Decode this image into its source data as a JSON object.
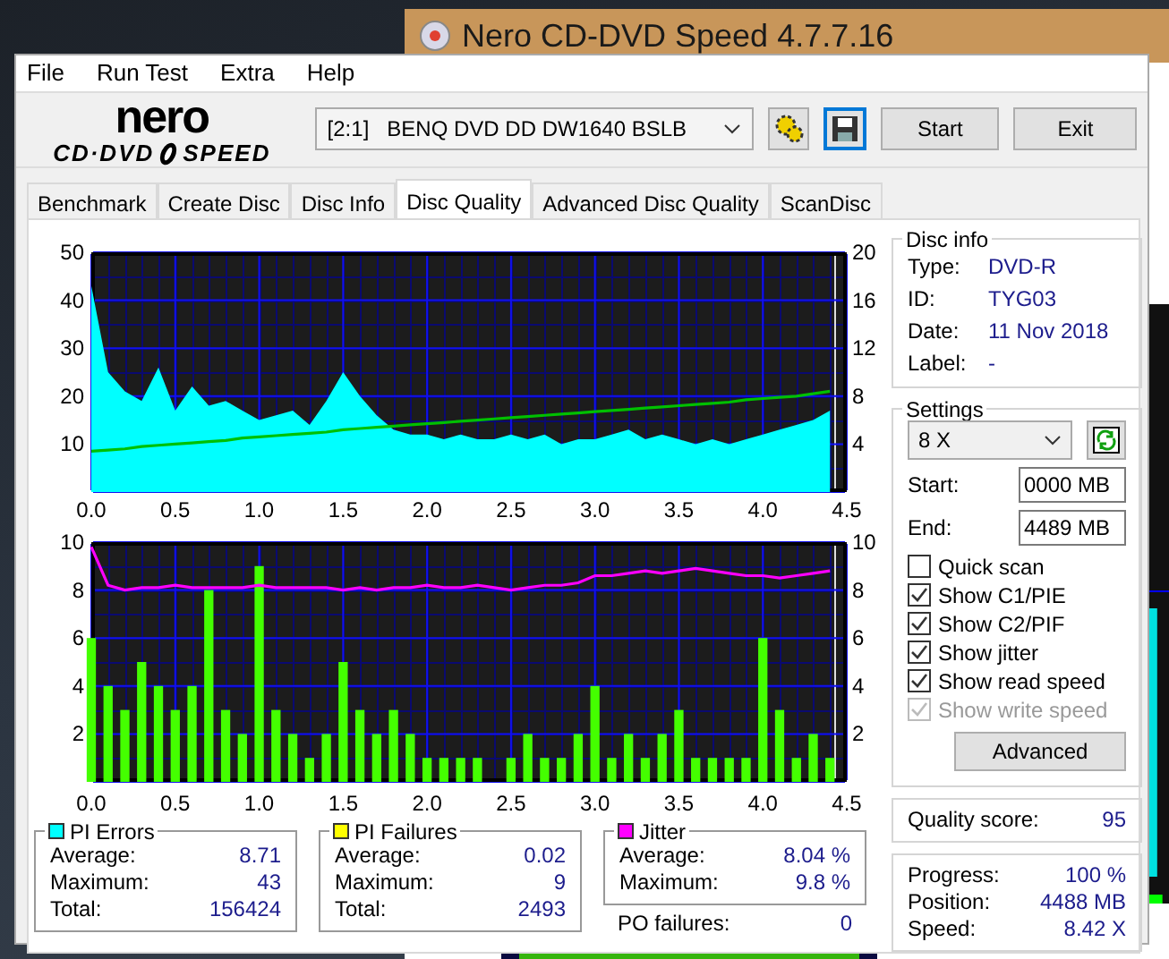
{
  "background_window": {
    "title": "Nero CD-DVD Speed 4.7.7.16"
  },
  "menu": [
    "File",
    "Run Test",
    "Extra",
    "Help"
  ],
  "logo": {
    "top": "nero",
    "left": "CD·DVD",
    "right": "SPEED"
  },
  "drive": {
    "id": "[2:1]",
    "name": "BENQ DVD DD DW1640 BSLB"
  },
  "buttons": [
    "Start",
    "Exit"
  ],
  "tabs": [
    {
      "label": "Benchmark",
      "selected": false
    },
    {
      "label": "Create Disc",
      "selected": false
    },
    {
      "label": "Disc Info",
      "selected": false
    },
    {
      "label": "Disc Quality",
      "selected": true
    },
    {
      "label": "Advanced Disc Quality",
      "selected": false
    },
    {
      "label": "ScanDisc",
      "selected": false
    }
  ],
  "charts": [
    {
      "chart_data": {
        "type": "area",
        "grid": true,
        "xlim": [
          0,
          4.5
        ],
        "ylim": [
          0,
          50
        ],
        "y2lim": [
          0,
          20
        ],
        "xticks": [
          {
            "value": 0,
            "label": "0.0"
          },
          {
            "value": 0.5,
            "label": "0.5"
          },
          {
            "value": 1,
            "label": "1.0"
          },
          {
            "value": 1.5,
            "label": "1.5"
          },
          {
            "value": 2,
            "label": "2.0"
          },
          {
            "value": 2.5,
            "label": "2.5"
          },
          {
            "value": 3,
            "label": "3.0"
          },
          {
            "value": 3.5,
            "label": "3.5"
          },
          {
            "value": 4,
            "label": "4.0"
          },
          {
            "value": 4.5,
            "label": "4.5"
          }
        ],
        "yticks": [
          {
            "value": 10,
            "label": "10"
          },
          {
            "value": 20,
            "label": "20"
          },
          {
            "value": 30,
            "label": "30"
          },
          {
            "value": 40,
            "label": "40"
          },
          {
            "value": 50,
            "label": "50"
          }
        ],
        "y2ticks": [
          {
            "value": 4,
            "label": "4"
          },
          {
            "value": 8,
            "label": "8"
          },
          {
            "value": 12,
            "label": "12"
          },
          {
            "value": 16,
            "label": "16"
          },
          {
            "value": 20,
            "label": "20"
          }
        ],
        "x": [
          0,
          0.1,
          0.2,
          0.3,
          0.4,
          0.5,
          0.6,
          0.7,
          0.8,
          0.9,
          1,
          1.1,
          1.2,
          1.3,
          1.4,
          1.5,
          1.6,
          1.7,
          1.8,
          1.9,
          2,
          2.1,
          2.2,
          2.3,
          2.4,
          2.5,
          2.6,
          2.7,
          2.8,
          2.9,
          3,
          3.1,
          3.2,
          3.3,
          3.4,
          3.5,
          3.6,
          3.7,
          3.8,
          3.9,
          4,
          4.1,
          4.2,
          4.3,
          4.4
        ],
        "series": [
          {
            "color": "#00ffff",
            "values": [
              43,
              25,
              21,
              19,
              26,
              17,
              22,
              18,
              19,
              17,
              15,
              16,
              17,
              14,
              19,
              25,
              20,
              16,
              13,
              12,
              12,
              11,
              12,
              11,
              11,
              12,
              11,
              12,
              10,
              11,
              11,
              12,
              13,
              11,
              12,
              11,
              10,
              11,
              10,
              11,
              12,
              13,
              14,
              15,
              17
            ]
          },
          {
            "type": "line",
            "axis": "y2",
            "color": "#00c000",
            "values": [
              3.4,
              3.5,
              3.6,
              3.8,
              3.9,
              4.0,
              4.1,
              4.2,
              4.3,
              4.5,
              4.6,
              4.7,
              4.8,
              4.9,
              5.0,
              5.2,
              5.3,
              5.4,
              5.5,
              5.6,
              5.7,
              5.8,
              5.9,
              6.0,
              6.1,
              6.2,
              6.3,
              6.4,
              6.5,
              6.6,
              6.7,
              6.8,
              6.9,
              7.0,
              7.1,
              7.2,
              7.3,
              7.4,
              7.5,
              7.7,
              7.8,
              7.9,
              8.0,
              8.2,
              8.4
            ]
          }
        ]
      }
    },
    {
      "chart_data": {
        "type": "bar",
        "grid": true,
        "xlim": [
          0,
          4.5
        ],
        "ylim": [
          0,
          10
        ],
        "y2lim": [
          0,
          10
        ],
        "xticks": [
          {
            "value": 0,
            "label": "0.0"
          },
          {
            "value": 0.5,
            "label": "0.5"
          },
          {
            "value": 1,
            "label": "1.0"
          },
          {
            "value": 1.5,
            "label": "1.5"
          },
          {
            "value": 2,
            "label": "2.0"
          },
          {
            "value": 2.5,
            "label": "2.5"
          },
          {
            "value": 3,
            "label": "3.0"
          },
          {
            "value": 3.5,
            "label": "3.5"
          },
          {
            "value": 4,
            "label": "4.0"
          },
          {
            "value": 4.5,
            "label": "4.5"
          }
        ],
        "yticks": [
          2,
          4,
          6,
          8,
          10
        ],
        "y2ticks": [
          2,
          4,
          6,
          8,
          10
        ],
        "x": [
          0,
          0.1,
          0.2,
          0.3,
          0.4,
          0.5,
          0.6,
          0.7,
          0.8,
          0.9,
          1,
          1.1,
          1.2,
          1.3,
          1.4,
          1.5,
          1.6,
          1.7,
          1.8,
          1.9,
          2,
          2.1,
          2.2,
          2.3,
          2.4,
          2.5,
          2.6,
          2.7,
          2.8,
          2.9,
          3,
          3.1,
          3.2,
          3.3,
          3.4,
          3.5,
          3.6,
          3.7,
          3.8,
          3.9,
          4,
          4.1,
          4.2,
          4.3,
          4.4
        ],
        "series": [
          {
            "color": "#44ff00",
            "values": [
              6,
              4,
              3,
              5,
              4,
              3,
              4,
              8,
              3,
              2,
              9,
              3,
              2,
              1,
              2,
              5,
              3,
              2,
              3,
              2,
              1,
              1,
              1,
              1,
              0,
              1,
              2,
              1,
              1,
              2,
              4,
              1,
              2,
              1,
              2,
              3,
              1,
              1,
              1,
              1,
              6,
              3,
              1,
              2,
              1
            ]
          },
          {
            "type": "line",
            "color": "#ff00ff",
            "values": [
              9.8,
              8.2,
              8.0,
              8.1,
              8.1,
              8.2,
              8.1,
              8.1,
              8.1,
              8.1,
              8.2,
              8.1,
              8.1,
              8.1,
              8.1,
              8.0,
              8.1,
              8.0,
              8.1,
              8.1,
              8.2,
              8.1,
              8.1,
              8.2,
              8.1,
              8.0,
              8.1,
              8.2,
              8.2,
              8.3,
              8.6,
              8.6,
              8.7,
              8.8,
              8.7,
              8.8,
              8.9,
              8.8,
              8.7,
              8.6,
              8.6,
              8.5,
              8.6,
              8.7,
              8.8
            ]
          }
        ]
      }
    }
  ],
  "stats": [
    {
      "title": "PI Errors",
      "color": "#00ffff",
      "rows": [
        {
          "label": "Average:",
          "value": "8.71"
        },
        {
          "label": "Maximum:",
          "value": "43"
        },
        {
          "label": "Total:",
          "value": "156424"
        }
      ]
    },
    {
      "title": "PI Failures",
      "color": "#ffff00",
      "rows": [
        {
          "label": "Average:",
          "value": "0.02"
        },
        {
          "label": "Maximum:",
          "value": "9"
        },
        {
          "label": "Total:",
          "value": "2493"
        }
      ]
    },
    {
      "title": "Jitter",
      "color": "#ff00ff",
      "rows": [
        {
          "label": "Average:",
          "value": "8.04 %"
        },
        {
          "label": "Maximum:",
          "value": "9.8 %"
        }
      ]
    }
  ],
  "po_failures": {
    "label": "PO failures:",
    "value": "0"
  },
  "disc_info": {
    "title": "Disc info",
    "rows": [
      {
        "label": "Type:",
        "value": "DVD-R"
      },
      {
        "label": "ID:",
        "value": "TYG03"
      },
      {
        "label": "Date:",
        "value": "11 Nov 2018"
      },
      {
        "label": "Label:",
        "value": "-"
      }
    ]
  },
  "settings": {
    "title": "Settings",
    "speed": "8 X",
    "start": {
      "label": "Start:",
      "value": "0000 MB"
    },
    "end": {
      "label": "End:",
      "value": "4489 MB"
    },
    "options": [
      {
        "label": "Quick scan",
        "checked": false,
        "disabled": false
      },
      {
        "label": "Show C1/PIE",
        "checked": true,
        "disabled": false
      },
      {
        "label": "Show C2/PIF",
        "checked": true,
        "disabled": false
      },
      {
        "label": "Show jitter",
        "checked": true,
        "disabled": false
      },
      {
        "label": "Show read speed",
        "checked": true,
        "disabled": false
      },
      {
        "label": "Show write speed",
        "checked": true,
        "disabled": true
      }
    ],
    "button": "Advanced"
  },
  "quality": {
    "label": "Quality score:",
    "value": "95"
  },
  "progress": [
    {
      "label": "Progress:",
      "value": "100 %"
    },
    {
      "label": "Position:",
      "value": "4488 MB"
    },
    {
      "label": "Speed:",
      "value": "8.42 X"
    }
  ]
}
